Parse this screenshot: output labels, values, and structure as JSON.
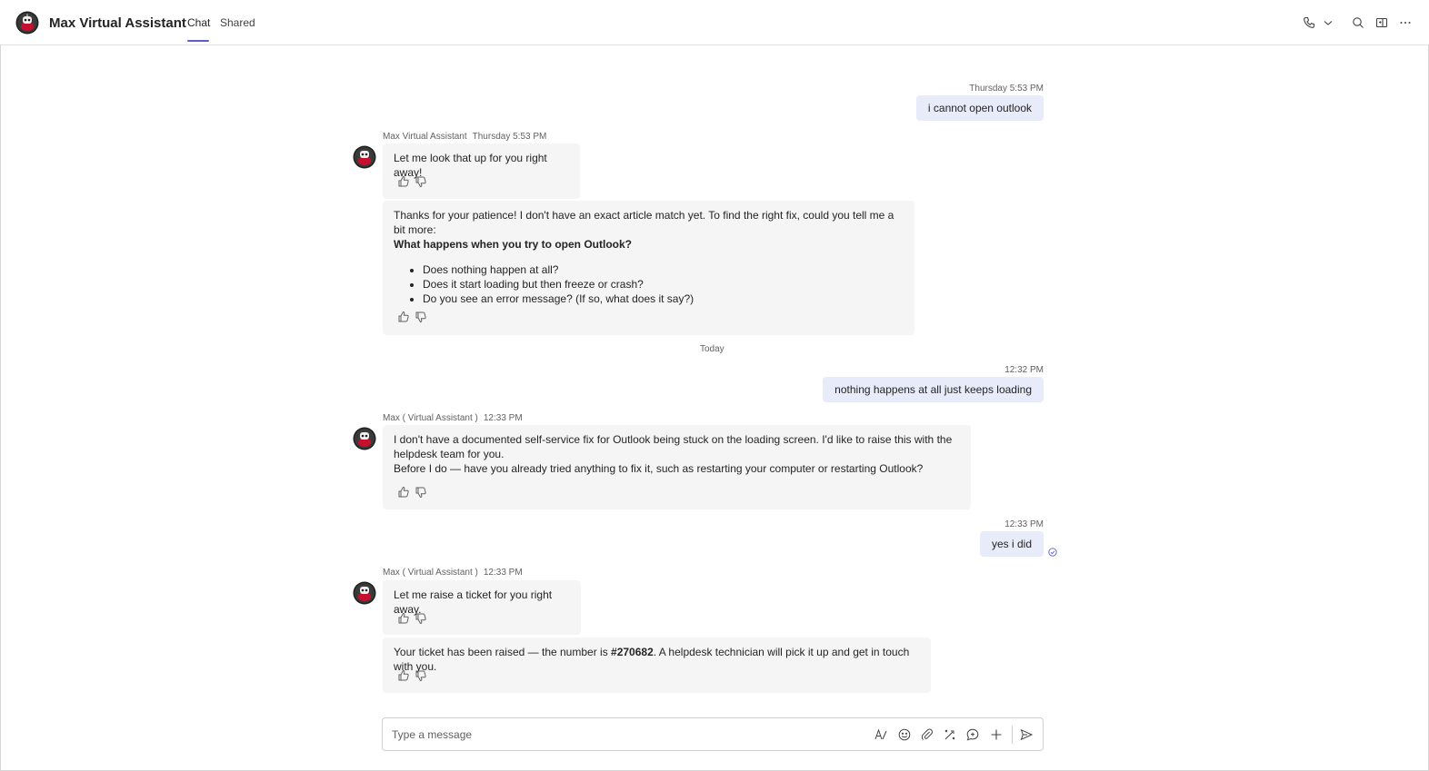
{
  "header": {
    "title": "Max Virtual Assistant",
    "tabs": [
      {
        "label": "Chat",
        "active": true
      },
      {
        "label": "Shared",
        "active": false
      }
    ],
    "icons": [
      "phone-icon",
      "chevron-down-icon",
      "search-icon",
      "popout-icon",
      "more-icon"
    ]
  },
  "messages": {
    "m1": {
      "time": "Thursday 5:53 PM",
      "text": "i cannot open outlook"
    },
    "m2": {
      "sender": "Max Virtual Assistant",
      "time": "Thursday 5:53 PM",
      "text": "Let me look that up for you right away!"
    },
    "m3": {
      "intro": "Thanks for your patience! I don't have an exact article match yet. To find the right fix, could you tell me a bit more:",
      "question": "What happens when you try to open Outlook?",
      "options": [
        "Does nothing happen at all?",
        "Does it start loading but then freeze or crash?",
        "Do you see an error message? (If so, what does it say?)"
      ]
    },
    "separator": "Today",
    "m4": {
      "time": "12:32 PM",
      "text": "nothing happens at all just keeps loading"
    },
    "m5": {
      "sender": "Max ( Virtual Assistant )",
      "time": "12:33 PM",
      "line1": "I don't have a documented self-service fix for Outlook being stuck on the loading screen. I'd like to raise this with the helpdesk team for you.",
      "line2": "Before I do — have you already tried anything to fix it, such as restarting your computer or restarting Outlook?"
    },
    "m6": {
      "time": "12:33 PM",
      "text": "yes i did"
    },
    "m7": {
      "sender": "Max ( Virtual Assistant )",
      "time": "12:33 PM",
      "text": "Let me raise a ticket for you right away."
    },
    "m8": {
      "prefix": "Your ticket has been raised — the number is ",
      "ticket": "#270682",
      "suffix": ". A helpdesk technician will pick it up and get in touch with you."
    }
  },
  "compose": {
    "placeholder": "Type a message",
    "icons": [
      "format-icon",
      "emoji-icon",
      "attach-icon",
      "loop-icon",
      "message-extension-icon",
      "plus-icon",
      "send-icon"
    ]
  },
  "colors": {
    "accent": "#5b5fc7",
    "my_bubble": "#e8ebfa",
    "bot_bubble": "#f5f5f5"
  }
}
